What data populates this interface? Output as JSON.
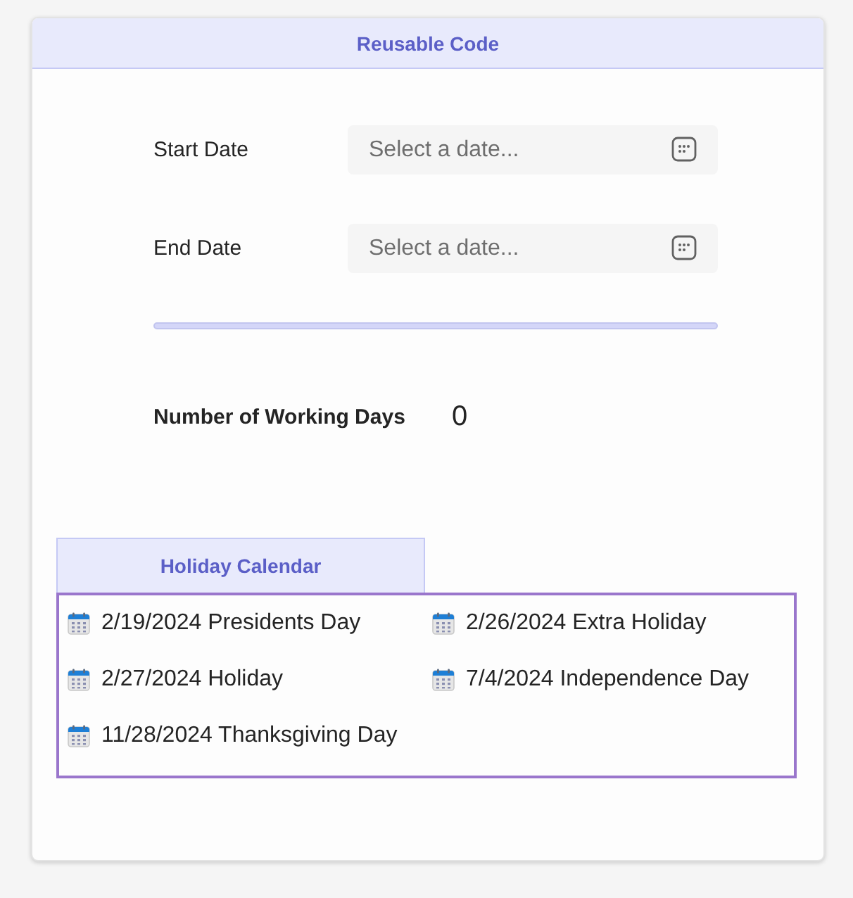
{
  "header": {
    "title": "Reusable Code"
  },
  "form": {
    "fields": [
      {
        "label": "Start Date",
        "placeholder": "Select a date..."
      },
      {
        "label": "End Date",
        "placeholder": "Select a date..."
      }
    ],
    "result": {
      "label": "Number of Working Days",
      "value": "0"
    }
  },
  "holiday_calendar": {
    "tab": {
      "label": "Holiday Calendar"
    },
    "holidays": [
      "2/19/2024 Presidents Day",
      "2/26/2024 Extra Holiday",
      "2/27/2024 Holiday",
      "7/4/2024 Independence Day",
      "11/28/2024 Thanksgiving Day"
    ]
  }
}
